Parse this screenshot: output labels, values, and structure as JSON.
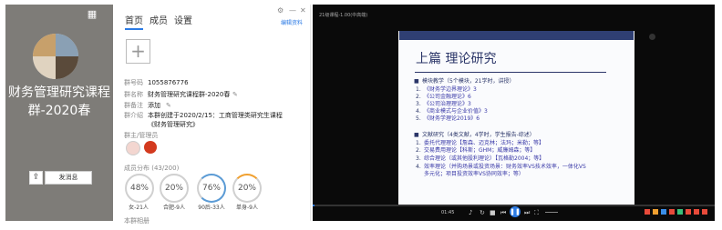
{
  "group_card": {
    "title": "财务管理研究课程群-2020春",
    "send_label": "发消息",
    "avatar_colors": [
      "#c7a06b",
      "#8aa0b4",
      "#e0d3c0",
      "#5a4a3a"
    ]
  },
  "tabs": [
    {
      "label": "首页",
      "active": true
    },
    {
      "label": "成员",
      "active": false
    },
    {
      "label": "设置",
      "active": false
    }
  ],
  "window_controls": [
    "⚙",
    "—",
    "✕"
  ],
  "edit_link": "编辑资料",
  "info": {
    "number": "1055876776",
    "name_label": "群名称",
    "name_value": "财务管理研究课程群-2020春",
    "remark_label": "群备注",
    "remark_value": "添加",
    "intro_label": "群介绍",
    "intro_value": "本群创建于2020/2/15：工商管理类研究生课程《财务管理研究》",
    "number_label": "群号码"
  },
  "admins_label": "群主/管理员",
  "distribution": {
    "label": "成员分布 (43/200)",
    "items": [
      {
        "percent": "48%",
        "label": "女-21人",
        "color": "#d0d0d0"
      },
      {
        "percent": "20%",
        "label": "合肥-9人",
        "color": "#d0d0d0"
      },
      {
        "percent": "76%",
        "label": "90后-33人",
        "color": "#5b9bd5"
      },
      {
        "percent": "20%",
        "label": "单身-9人",
        "color": "#d0d0d0"
      }
    ]
  },
  "bottom_label": "本群相册",
  "video": {
    "title": "21级课程-1.00(中高端)",
    "slide_title": "上篇  理论研究",
    "bullet1": "模块教学（5个模块，21学时，讲授）",
    "list1": [
      {
        "num": "1.",
        "text": "《财务学边界理论》3"
      },
      {
        "num": "2.",
        "text": "《公司金融理论》6"
      },
      {
        "num": "3.",
        "text": "《公司治理理论》3"
      },
      {
        "num": "4.",
        "text": "《商业模式与企业价值》3"
      },
      {
        "num": "5.",
        "text": "《财务学理论2019》6"
      }
    ],
    "bullet2": "文献研究（4类文献，4学时，学生报告-综述）",
    "list2": [
      {
        "num": "1.",
        "text": "委托代理理论【詹森、迈克林；法玛；米勒；等】"
      },
      {
        "num": "2.",
        "text": "交易费用理论【科斯；GHM；威廉姆森；等】"
      },
      {
        "num": "3.",
        "text": "综合理论（或其他股利理论）【瓦格勒2004；等】"
      },
      {
        "num": "4.",
        "text": "效率理论（并购场景或投资场景：财务效率VS技术效率，一体化VS"
      },
      {
        "num": "",
        "text": "多元化；项目投资效率VS协同效率；等）"
      }
    ],
    "time": "01:45",
    "tray_colors": [
      "#e84a3a",
      "#f0a030",
      "#3a8ee8",
      "#e84a3a",
      "#3ac07a",
      "#e84a3a",
      "#e84a3a",
      "#e84a3a"
    ]
  }
}
